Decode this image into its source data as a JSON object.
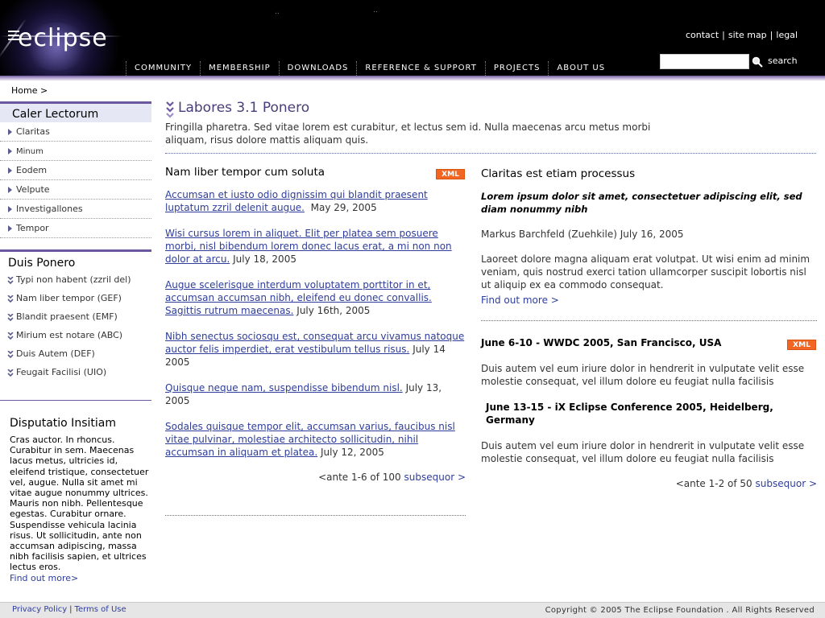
{
  "header": {
    "logo": "eclipse",
    "utility_links": [
      "contact",
      "site map",
      "legal"
    ],
    "nav": [
      "COMMUNITY",
      "MEMBERSHIP",
      "DOWNLOADS",
      "REFERENCE & SUPPORT",
      "PROJECTS",
      "ABOUT US"
    ],
    "search_label": "search",
    "search_value": ""
  },
  "breadcrumb": "Home >",
  "left": {
    "menu_title": "Caler Lectorum",
    "menu_items": [
      "Claritas",
      "Minum",
      "Eodem",
      "Velpute",
      "Investigallones",
      "Tempor"
    ],
    "duis_title": "Duis Ponero",
    "duis_items": [
      "Typi non habent (zzril del)",
      "Nam liber tempor (GEF)",
      "Blandit praesent (EMF)",
      "Mirium est notare (ABC)",
      "Duis Autem (DEF)",
      "Feugait Facilisi (UIO)"
    ],
    "disputatio_title": "Disputatio Insitiam",
    "disputatio_text": "Cras auctor. In rhoncus. Curabitur in sem. Maecenas lacus metus, ultricies id, eleifend tristique, consectetuer vel, augue. Nulla sit amet mi vitae augue nonummy ultrices. Mauris non nibh. Pellentesque egestas. Curabitur ornare. Suspendisse vehicula lacinia risus. Ut sollicitudin, ante non accumsan adipiscing, massa nibh facilisis sapien, et ultrices lectus eros.",
    "disputatio_more": "Find out more>"
  },
  "main": {
    "title": "Labores 3.1 Ponero",
    "intro": "Fringilla pharetra. Sed vitae lorem est curabitur, et lectus sem id. Nulla maecenas arcu metus morbi aliquam, risus dolore mattis aliquam quis.",
    "xml_label": "XML",
    "news_title": "Nam liber tempor cum soluta",
    "news": [
      {
        "link": "Accumsan et iusto odio dignissim qui blandit praesent luptatum zzril delenit augue.",
        "date": "May 29, 2005"
      },
      {
        "link": "Wisi cursus lorem in aliquet. Elit per platea sem posuere morbi, nisl bibendum lorem donec lacus erat, a mi non non dolor at arcu.",
        "date": "July 18, 2005"
      },
      {
        "link": "Augue scelerisque interdum voluptatem porttitor in et, accumsan accumsan nibh, eleifend eu donec convallis. Sagittis rutrum maecenas.",
        "date": "July 16th, 2005"
      },
      {
        "link": "Nibh senectus sociosqu est, consequat arcu vivamus natoque auctor felis imperdiet, erat vestibulum tellus risus.",
        "date": "July 14 2005"
      },
      {
        "link": "Quisque neque nam, suspendisse bibendum nisl.",
        "date": "July 13, 2005"
      },
      {
        "link": "Sodales quisque tempor elit, accumsan varius, faucibus nisl vitae pulvinar, molestiae architecto sollicitudin, nihil accumsan in aliquam et platea.",
        "date": "July 12, 2005"
      }
    ],
    "news_pager": {
      "text": "<ante 1-6 of 100",
      "next": "subsequor >"
    },
    "feature_title": "Claritas est etiam processus",
    "feature_quote": "Lorem ipsum dolor sit amet, consectetuer adipiscing elit, sed diam nonummy nibh",
    "feature_author": "Markus Barchfeld (Zuehkile) July 16, 2005",
    "feature_body": "Laoreet dolore magna aliquam erat volutpat. Ut wisi enim ad minim veniam, quis nostrud exerci tation ullamcorper suscipit lobortis nisl ut aliquip ex ea commodo consequat.",
    "feature_more": "Find out more >",
    "events": [
      {
        "title": "June 6-10 - WWDC 2005, San Francisco, USA",
        "desc": "Duis autem vel eum iriure dolor in hendrerit in vulputate velit esse molestie consequat, vel illum dolore eu feugiat nulla facilisis"
      },
      {
        "title": "June 13-15 - iX Eclipse Conference 2005, Heidelberg, Germany",
        "desc": "Duis autem vel eum iriure dolor in hendrerit in vulputate velit esse molestie consequat, vel illum dolore eu feugiat nulla facilisis"
      }
    ],
    "events_pager": {
      "text": "<ante 1-2 of 50",
      "next": "subsequor >"
    }
  },
  "footer": {
    "links": [
      "Privacy Policy",
      "Terms of Use"
    ],
    "copyright": "Copyright © 2005  The Eclipse Foundation . All Rights Reserved"
  },
  "colors": {
    "accent_purple": "#6a57a0",
    "link_blue": "#2e3d9b",
    "xml_orange": "#f26522"
  }
}
